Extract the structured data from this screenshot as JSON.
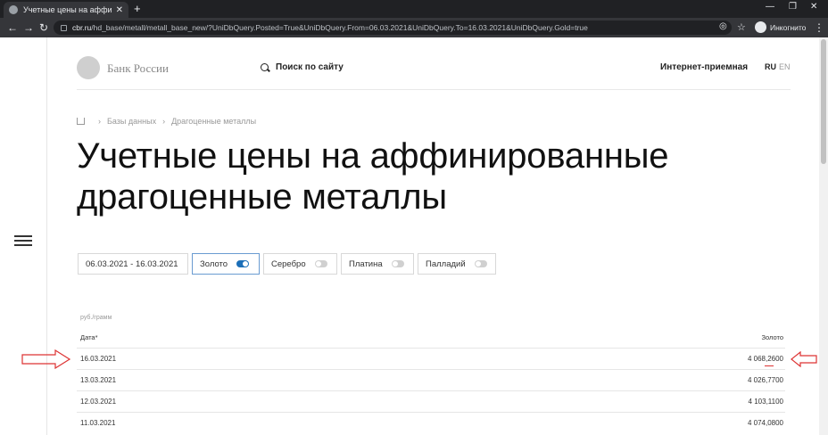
{
  "browser": {
    "tab_title": "Учетные цены на аффинирован",
    "url_domain": "cbr.ru",
    "url_path": "/hd_base/metall/metall_base_new/?UniDbQuery.Posted=True&UniDbQuery.From=06.03.2021&UniDbQuery.To=16.03.2021&UniDbQuery.Gold=true",
    "profile_label": "Инкогнито"
  },
  "header": {
    "brand": "Банк России",
    "search_label": "Поиск по сайту",
    "reception": "Интернет-приемная",
    "lang_ru": "RU",
    "lang_en": "EN"
  },
  "breadcrumb": {
    "items": [
      "Базы данных",
      "Драгоценные металлы"
    ]
  },
  "page_title": "Учетные цены на аффинированные драгоценные металлы",
  "filters": {
    "date_range": "06.03.2021 - 16.03.2021",
    "metals": [
      {
        "label": "Золото",
        "on": true
      },
      {
        "label": "Серебро",
        "on": false
      },
      {
        "label": "Платина",
        "on": false
      },
      {
        "label": "Палладий",
        "on": false
      }
    ]
  },
  "table": {
    "unit": "руб./грамм",
    "col_date": "Дата*",
    "col_gold": "Золото",
    "rows": [
      {
        "date": "16.03.2021",
        "gold": "4 068,2600"
      },
      {
        "date": "13.03.2021",
        "gold": "4 026,7700"
      },
      {
        "date": "12.03.2021",
        "gold": "4 103,1100"
      },
      {
        "date": "11.03.2021",
        "gold": "4 074,0800"
      }
    ]
  },
  "colors": {
    "toggle_on": "#1c6fb8",
    "annotation_red": "#d33"
  }
}
